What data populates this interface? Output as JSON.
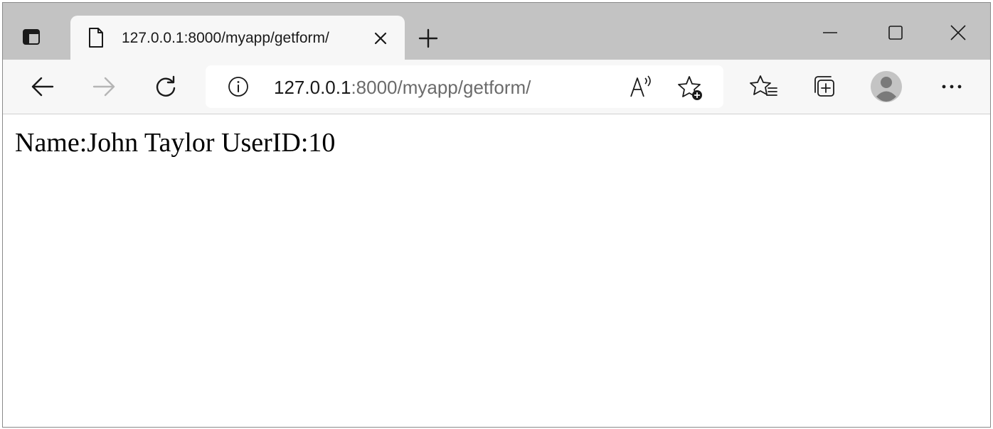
{
  "browser": {
    "tab": {
      "title": "127.0.0.1:8000/myapp/getform/",
      "favicon": "page-icon"
    },
    "address": {
      "host": "127.0.0.1",
      "rest": ":8000/myapp/getform/"
    },
    "icons": {
      "tab_actions": "tab-actions-icon",
      "close_tab": "close-icon",
      "new_tab": "plus-icon",
      "minimize": "minimize-icon",
      "maximize": "maximize-icon",
      "close_window": "close-icon",
      "back": "arrow-left-icon",
      "forward": "arrow-right-icon",
      "refresh": "refresh-icon",
      "site_info": "info-icon",
      "read_aloud": "read-aloud-icon",
      "add_favorite": "star-add-icon",
      "favorites": "favorites-icon",
      "collections": "collections-icon",
      "profile": "avatar-icon",
      "more": "more-icon"
    },
    "colors": {
      "tabstrip": "#c3c3c3",
      "toolbar": "#f7f7f7",
      "url_host": "#1a1a1a",
      "url_rest": "#6b6b6b"
    }
  },
  "page": {
    "content_text": "Name:John Taylor UserID:10"
  }
}
